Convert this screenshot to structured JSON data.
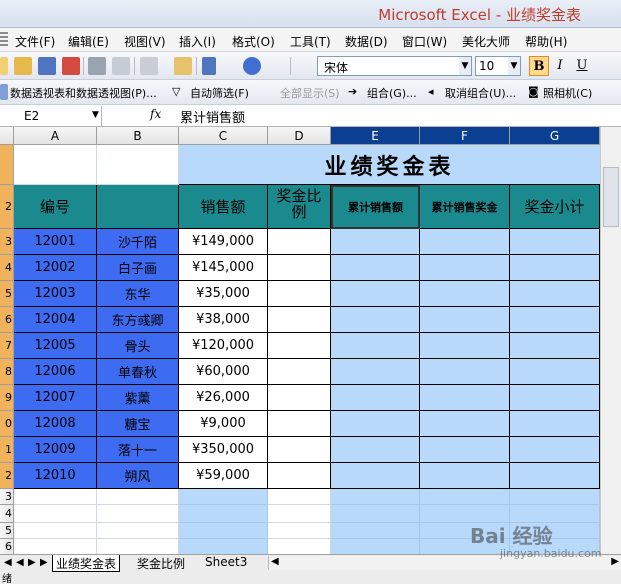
{
  "window": {
    "title": "Microsoft Excel - 业绩奖金表"
  },
  "menu": [
    {
      "label": "文件(F)"
    },
    {
      "label": "编辑(E)"
    },
    {
      "label": "视图(V)"
    },
    {
      "label": "插入(I)"
    },
    {
      "label": "格式(O)"
    },
    {
      "label": "工具(T)"
    },
    {
      "label": "数据(D)"
    },
    {
      "label": "窗口(W)"
    },
    {
      "label": "美化大师"
    },
    {
      "label": "帮助(H)"
    }
  ],
  "toolbar": {
    "font": "宋体",
    "size": "10",
    "bold": "B",
    "italic": "I",
    "underline": "U"
  },
  "pivot_toolbar": {
    "pivot": "数据透视表和数据透视图(P)...",
    "autofilter": "自动筛选(F)",
    "show_all": "全部显示(S)",
    "group": "组合(G)...",
    "ungroup": "取消组合(U)...",
    "camera": "照相机(C)"
  },
  "formula_bar": {
    "cell_ref": "E2",
    "fx": "fx",
    "value": "累计销售额"
  },
  "columns": [
    "A",
    "B",
    "C",
    "D",
    "E",
    "F",
    "G"
  ],
  "sheet": {
    "title": "业绩奖金表",
    "headers": [
      "编号",
      "",
      "销售额",
      "奖金比例",
      "累计销售额",
      "累计销售奖金",
      "奖金小计"
    ],
    "rows": [
      {
        "id": "12001",
        "name": "沙千陌",
        "sales": "¥149,000"
      },
      {
        "id": "12002",
        "name": "白子画",
        "sales": "¥145,000"
      },
      {
        "id": "12003",
        "name": "东华",
        "sales": "¥35,000"
      },
      {
        "id": "12004",
        "name": "东方彧卿",
        "sales": "¥38,000"
      },
      {
        "id": "12005",
        "name": "骨头",
        "sales": "¥120,000"
      },
      {
        "id": "12006",
        "name": "单春秋",
        "sales": "¥60,000"
      },
      {
        "id": "12007",
        "name": "紫薰",
        "sales": "¥26,000"
      },
      {
        "id": "12008",
        "name": "糖宝",
        "sales": "¥9,000"
      },
      {
        "id": "12009",
        "name": "落十一",
        "sales": "¥350,000"
      },
      {
        "id": "12010",
        "name": "朔风",
        "sales": "¥59,000"
      }
    ]
  },
  "row_numbers": [
    "",
    "2",
    "3",
    "4",
    "5",
    "6",
    "7",
    "8",
    "9",
    "0",
    "1",
    "2",
    "3",
    "4",
    "5",
    "6"
  ],
  "tabs": [
    "业绩奖金表",
    "奖金比例",
    "Sheet3"
  ],
  "status": {
    "text": "绪"
  },
  "watermark": {
    "main": "Bai 经验",
    "sub": "jingyan.baidu.com"
  }
}
